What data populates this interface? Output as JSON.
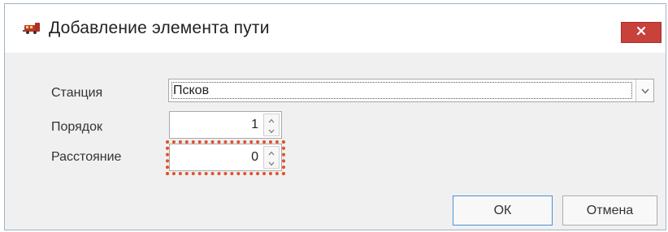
{
  "dialog": {
    "title": "Добавление элемента пути",
    "icon": "train-icon",
    "close_icon": "close-icon"
  },
  "form": {
    "station": {
      "label": "Станция",
      "value": "Псков"
    },
    "order": {
      "label": "Порядок",
      "value": "1"
    },
    "distance": {
      "label": "Расстояние",
      "value": "0"
    }
  },
  "buttons": {
    "ok": "ОК",
    "cancel": "Отмена"
  },
  "colors": {
    "close_button": "#c9413b",
    "highlight": "#e2502a",
    "primary_border": "#4a90d9"
  }
}
